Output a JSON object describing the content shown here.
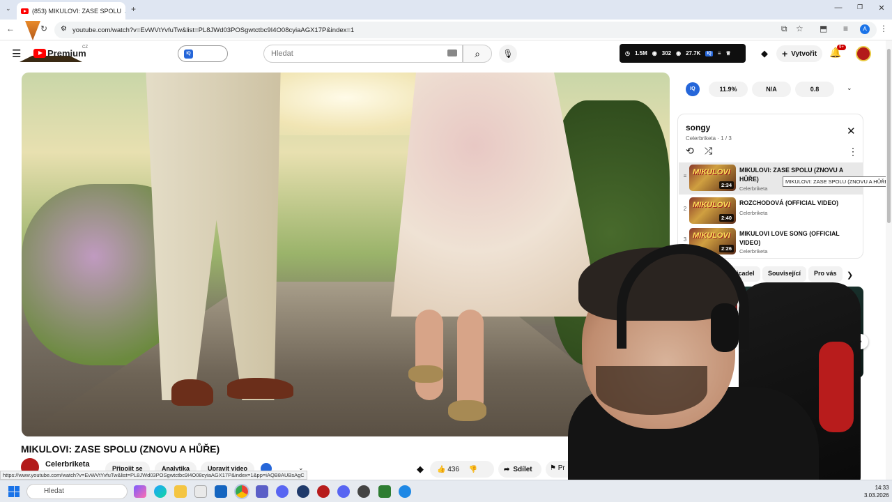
{
  "browser": {
    "tab_title": "(853) MIKULOVI: ZASE SPOLU",
    "url": "youtube.com/watch?v=EvWVtYvfuTw&list=PL8JWd03POSgwtctbc9I4O08cyiaAGX17P&index=1",
    "status_url": "https://www.youtube.com/watch?v=EvWVtYvfuTw&list=PL8JWd03POSgwtctbc9I4O08cyiaAGX17P&index=1&pp=iAQB8AUBsAgC",
    "profile_initial": "A"
  },
  "masthead": {
    "logo_text": "Premium",
    "logo_country": "CZ",
    "search_placeholder": "Hledat",
    "stats": {
      "views": "1.5M",
      "watching": "302",
      "likes": "27.7K"
    },
    "create_label": "Vytvořit",
    "notification_count": "9+"
  },
  "video": {
    "title": "MIKULOVI: ZASE SPOLU (ZNOVU A HŮŘE)",
    "channel": "Celerbriketa",
    "actions": [
      "Připojit se",
      "Analytika",
      "Upravit video"
    ],
    "likes": "436",
    "share_label": "Sdílet",
    "report_label": "Pr"
  },
  "extension": {
    "badge": "IQ",
    "values": [
      "11.9%",
      "N/A",
      "0.8"
    ]
  },
  "playlist": {
    "title": "songy",
    "subtitle": "Celerbriketa · 1 / 3",
    "items": [
      {
        "index": "",
        "title": "MIKULOVI: ZASE SPOLU (ZNOVU A HŮŘE)",
        "channel": "Celerbriketa",
        "duration": "2:34",
        "thumb_text": "MIKULOVI"
      },
      {
        "index": "2",
        "title": "ROZCHODOVÁ (OFFICIAL VIDEO)",
        "channel": "Celerbriketa",
        "duration": "2:40",
        "thumb_text": "MIKULOVI"
      },
      {
        "index": "3",
        "title": "MIKULOVI LOVE SONG (OFFICIAL VIDEO)",
        "channel": "Celerbriketa",
        "duration": "2:26",
        "thumb_text": "MIKULOVI"
      }
    ],
    "tooltip": "MIKULOVI: ZASE SPOLU (ZNOVU A HŮŘE)"
  },
  "chips": [
    "Shopaholicadel",
    "Související",
    "Pro vás"
  ],
  "taskbar": {
    "search_placeholder": "Hledat",
    "time": "14:33",
    "date": "3.03.2026"
  },
  "colors": {
    "brand_red": "#ff0000",
    "accent_blue": "#2566d9"
  }
}
